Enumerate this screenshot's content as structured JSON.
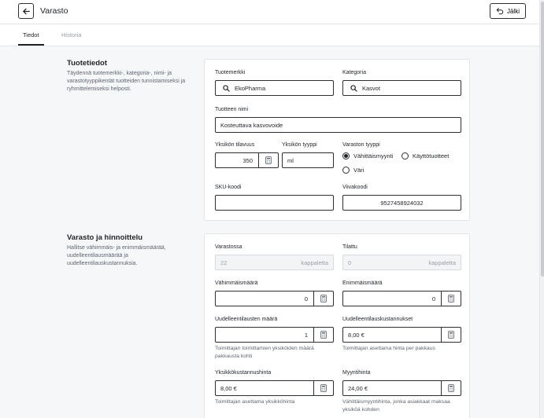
{
  "header": {
    "title": "Varasto",
    "undo_label": "Jälki"
  },
  "tabs": [
    {
      "label": "Tiedot",
      "active": true
    },
    {
      "label": "Historia",
      "active": false
    }
  ],
  "product_info": {
    "title": "Tuotetiedot",
    "description": "Täydennä tuotemerkki-, kategoria-, nimi- ja varastotyyppikentät tuotteiden tunnistamiseksi ja ryhmittelemiseksi helposti.",
    "brand": {
      "label": "Tuotemerkki",
      "value": "EkoPharma"
    },
    "category": {
      "label": "Kategoria",
      "value": "Kasvot"
    },
    "name": {
      "label": "Tuotteen nimi",
      "value": "Kosteuttava kasvovoide"
    },
    "unit_volume": {
      "label": "Yksikön tilavuus",
      "value": "350"
    },
    "unit_type": {
      "label": "Yksikön tyyppi",
      "value": "ml"
    },
    "storage_type": {
      "label": "Varaston tyyppi",
      "options": [
        {
          "label": "Vähittäismyynti",
          "selected": true
        },
        {
          "label": "Käyttötuotteet",
          "selected": false
        },
        {
          "label": "Väri",
          "selected": false
        }
      ]
    },
    "sku": {
      "label": "SKU-koodi",
      "value": ""
    },
    "barcode": {
      "label": "Viivakoodi",
      "value": "9527458924032"
    }
  },
  "stock_pricing": {
    "title": "Varasto ja hinnoittelu",
    "description": "Hallitse vähimmäis- ja enimmäismäärää, uudelleentilausmäärää ja uudelleentilauskustannuksia.",
    "in_stock": {
      "label": "Varastossa",
      "value": "22",
      "unit": "kappaletta"
    },
    "ordered": {
      "label": "Tilattu",
      "value": "0",
      "unit": "kappaletta"
    },
    "min_qty": {
      "label": "Vähimmäismäärä",
      "value": "0"
    },
    "max_qty": {
      "label": "Enimmäismäärä",
      "value": "0"
    },
    "reorder_qty": {
      "label": "Uudelleentilausten määrä",
      "value": "1",
      "helper": "Toimittajan toimittamien yksiköiden määrä pakkausta kohti"
    },
    "reorder_cost": {
      "label": "Uudelleentilauskustannukset",
      "value": "8,00 €",
      "helper": "Toimittajan asettama hinta per pakkaus"
    },
    "unit_cost": {
      "label": "Yksikkökustannushinta",
      "value": "8,00 €",
      "helper": "Toimittajan asettama yksikköhinta"
    },
    "sale_price": {
      "label": "Myyntihinta",
      "value": "24,00 €",
      "helper": "Vähittäismyyntihinta, jonka asiakkaat maksaa yksiköä kohden"
    }
  }
}
